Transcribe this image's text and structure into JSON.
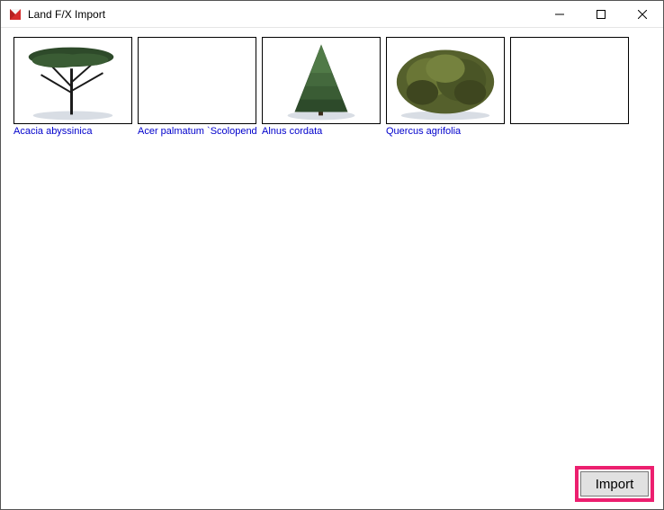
{
  "window": {
    "title": "Land F/X Import"
  },
  "items": [
    {
      "label": "Acacia abyssinica",
      "kind": "umbrella"
    },
    {
      "label": "Acer palmatum `Scolopendr",
      "kind": "blank"
    },
    {
      "label": "Alnus cordata",
      "kind": "conifer"
    },
    {
      "label": "Quercus agrifolia",
      "kind": "bushy"
    },
    {
      "label": "",
      "kind": "empty"
    }
  ],
  "footer": {
    "import_label": "Import"
  }
}
